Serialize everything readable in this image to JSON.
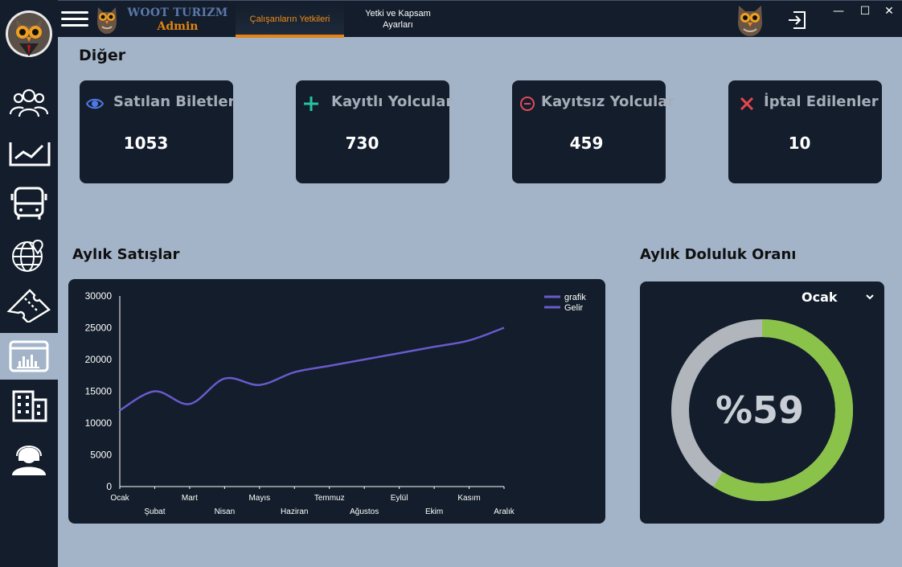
{
  "app": {
    "brand_line1": "WOOT TURIZM",
    "brand_line2": "Admin"
  },
  "tabs": [
    {
      "label": "Çalışanların Yetkileri",
      "active": true
    },
    {
      "label_line1": "Yetki ve Kapsam",
      "label_line2": "Ayarları",
      "active": false
    }
  ],
  "window_controls": {
    "minimize": "—",
    "maximize": "☐",
    "close": "✕"
  },
  "sidebar": {
    "items": [
      {
        "icon": "users-icon"
      },
      {
        "icon": "analytics-icon"
      },
      {
        "icon": "bus-icon"
      },
      {
        "icon": "globe-location-icon"
      },
      {
        "icon": "ticket-icon"
      },
      {
        "icon": "dashboard-chart-icon",
        "active": true
      },
      {
        "icon": "building-icon"
      },
      {
        "icon": "support-agent-icon"
      }
    ]
  },
  "section_other": "Diğer",
  "stats": [
    {
      "icon": "eye-icon",
      "label": "Satılan Biletler",
      "value": "1053",
      "color": "#4f78e6"
    },
    {
      "icon": "plus-icon",
      "label": "Kayıtlı Yolcular",
      "value": "730",
      "color": "#28c2a0"
    },
    {
      "icon": "minus-circle-icon",
      "label": "Kayıtsız Yolcular",
      "value": "459",
      "color": "#e04a5a"
    },
    {
      "icon": "x-icon",
      "label": "İptal Edilenler",
      "value": "10",
      "color": "#e8454c"
    }
  ],
  "monthly_sales_title": "Aylık Satışlar",
  "occupancy_title": "Aylık Doluluk Oranı",
  "occupancy": {
    "selected_month": "Ocak",
    "percent": 59,
    "percent_label": "%59",
    "fill_color": "#8bc34a",
    "track_color": "#b0b6bc"
  },
  "chart_data": {
    "type": "line",
    "categories": [
      "Ocak",
      "Şubat",
      "Mart",
      "Nisan",
      "Mayıs",
      "Haziran",
      "Temmuz",
      "Ağustos",
      "Eylül",
      "Ekim",
      "Kasım",
      "Aralık"
    ],
    "series": [
      {
        "name": "grafik",
        "values": [
          12000,
          15000,
          13000,
          17000,
          16000,
          18000,
          19000,
          20000,
          21000,
          22000,
          23000,
          25000
        ],
        "color": "#6a5acd"
      }
    ],
    "legend": [
      "grafik",
      "Gelir"
    ],
    "legend_placement": "top-right",
    "ylim": [
      0,
      30000
    ],
    "yticks": [
      "0",
      "5000",
      "10000",
      "15000",
      "20000",
      "25000",
      "30000"
    ],
    "grid": false
  }
}
